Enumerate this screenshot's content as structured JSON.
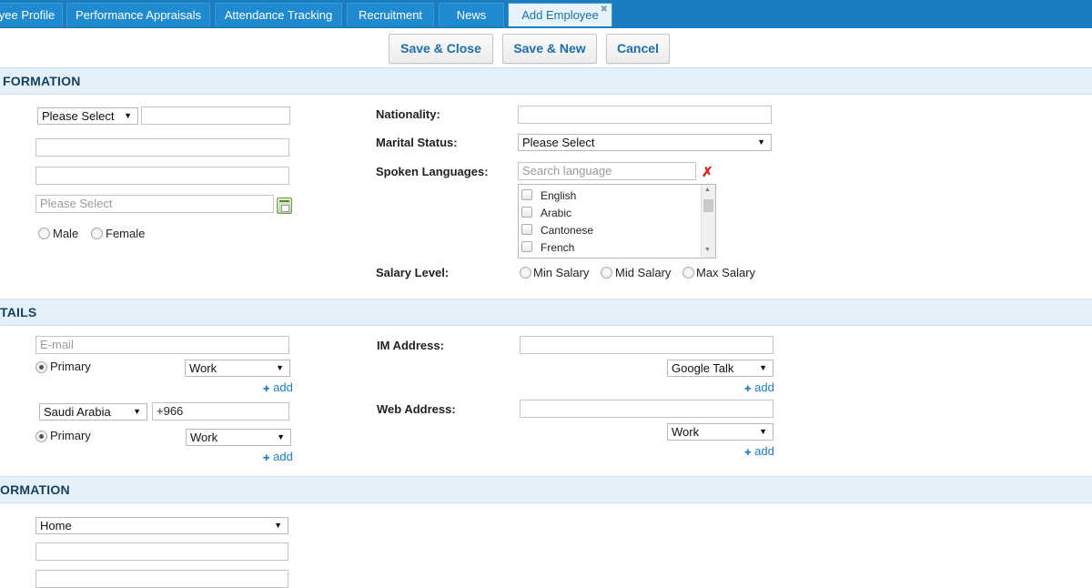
{
  "tabs": [
    {
      "label": "yee Profile",
      "active": false
    },
    {
      "label": "Performance Appraisals",
      "active": false
    },
    {
      "label": "Attendance Tracking",
      "active": false
    },
    {
      "label": "Recruitment",
      "active": false
    },
    {
      "label": "News",
      "active": false
    },
    {
      "label": "Add Employee",
      "active": true,
      "close_icon": "close-icon"
    }
  ],
  "toolbar": {
    "save_close": "Save & Close",
    "save_new": "Save & New",
    "cancel": "Cancel"
  },
  "sections": {
    "personal": "FORMATION",
    "contact": "TAILS",
    "address": "ORMATION"
  },
  "personal": {
    "title_select": "Please Select",
    "name_value": "",
    "field2_value": "",
    "field3_value": "",
    "birthdate_placeholder": "Please Select",
    "gender_options": [
      "Male",
      "Female"
    ],
    "nationality_label": "Nationality:",
    "nationality_value": "",
    "marital_label": "Marital Status:",
    "marital_value": "Please Select",
    "languages_label": "Spoken Languages:",
    "language_search_placeholder": "Search language",
    "languages": [
      "English",
      "Arabic",
      "Cantonese",
      "French"
    ],
    "salary_label": "Salary Level:",
    "salary_options": [
      "Min Salary",
      "Mid Salary",
      "Max Salary"
    ]
  },
  "contact": {
    "email_placeholder": "E-mail",
    "primary_label": "Primary",
    "email_type": "Work",
    "add_label": "add",
    "phone_country": "Saudi Arabia",
    "phone_code": "+966",
    "phone_type": "Work",
    "im_label": "IM Address:",
    "im_value": "",
    "im_type": "Google Talk",
    "web_label": "Web Address:",
    "web_value": "",
    "web_type": "Work"
  },
  "address": {
    "type": "Home",
    "line1": "",
    "line2": ""
  },
  "colors": {
    "tab_bar": "#1a7dbf",
    "section_bg": "#e4f1fa",
    "section_text": "#173f5f",
    "button_text": "#1d6ea8",
    "link": "#1d7ec2",
    "clear_icon": "#d9231b"
  }
}
